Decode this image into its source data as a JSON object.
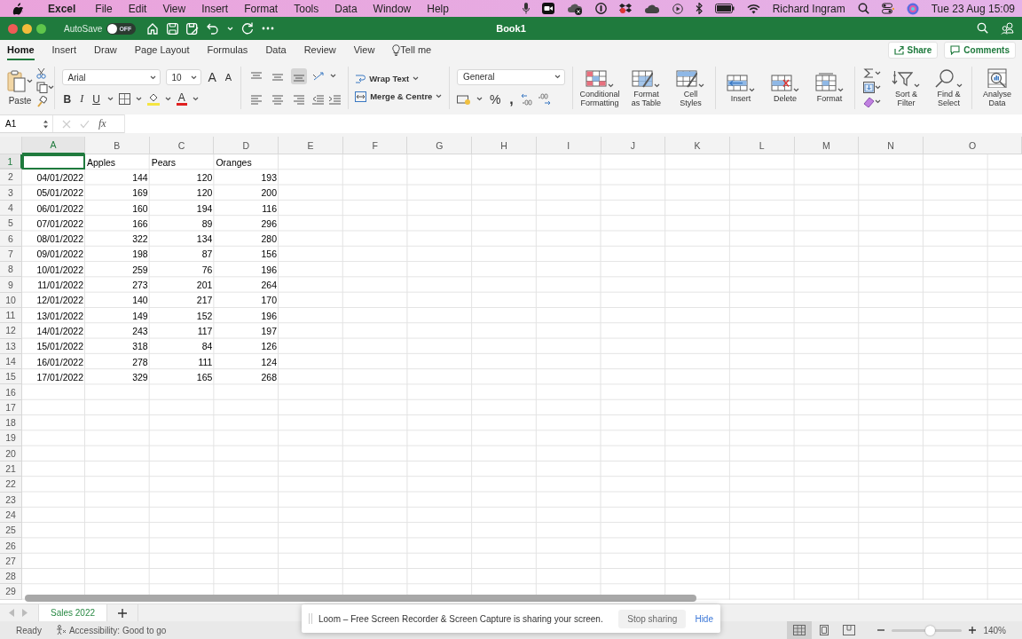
{
  "menubar": {
    "app": "Excel",
    "items": [
      "File",
      "Edit",
      "View",
      "Insert",
      "Format",
      "Tools",
      "Data",
      "Window",
      "Help"
    ],
    "user": "Richard Ingram",
    "clock": "Tue 23 Aug  15:09"
  },
  "titlebar": {
    "autosave_label": "AutoSave",
    "autosave_on": false,
    "toggle_text": "OFF",
    "title": "Book1"
  },
  "ribbon_tabs": [
    {
      "label": "Home",
      "selected": true
    },
    {
      "label": "Insert",
      "selected": false
    },
    {
      "label": "Draw",
      "selected": false
    },
    {
      "label": "Page Layout",
      "selected": false
    },
    {
      "label": "Formulas",
      "selected": false
    },
    {
      "label": "Data",
      "selected": false
    },
    {
      "label": "Review",
      "selected": false
    },
    {
      "label": "View",
      "selected": false
    }
  ],
  "tell_me": "Tell me",
  "share": "Share",
  "comments": "Comments",
  "ribbon": {
    "paste": "Paste",
    "font": {
      "name": "Arial",
      "size": "10",
      "size_buttons": [
        {
          "kind": "grow",
          "label": "A"
        },
        {
          "kind": "shrink",
          "label": "A"
        }
      ],
      "style_buttons": [
        {
          "kind": "bold",
          "label": "B"
        },
        {
          "kind": "italic",
          "label": "I"
        },
        {
          "kind": "underline",
          "label": "U"
        }
      ],
      "color_label": "A"
    },
    "alignment": {
      "vertical": [
        {
          "selected": false
        },
        {
          "selected": false
        },
        {
          "selected": true
        }
      ]
    },
    "wrap_text": "Wrap Text",
    "merge": "Merge & Centre",
    "number": {
      "format": "General",
      "symbols": [
        {
          "kind": "percent",
          "label": "%"
        },
        {
          "kind": "comma",
          "label": ","
        }
      ]
    },
    "big_buttons": [
      {
        "kind": "conditional",
        "label": "Conditional\nFormatting"
      },
      {
        "kind": "table",
        "label": "Format\nas Table"
      },
      {
        "kind": "styles",
        "label": "Cell\nStyles"
      },
      {
        "kind": "insert",
        "label": "Insert"
      },
      {
        "kind": "delete",
        "label": "Delete"
      },
      {
        "kind": "format",
        "label": "Format"
      },
      {
        "kind": "sort",
        "label": "Sort &\nFilter"
      },
      {
        "kind": "find",
        "label": "Find &\nSelect"
      },
      {
        "kind": "analyse",
        "label": "Analyse\nData"
      }
    ]
  },
  "formula_bar": {
    "cell_ref": "A1",
    "fx": "fx"
  },
  "sheet": {
    "columns": [
      {
        "label": "A",
        "selected": true
      },
      {
        "label": "B",
        "selected": false
      },
      {
        "label": "C",
        "selected": false
      },
      {
        "label": "D",
        "selected": false
      },
      {
        "label": "E",
        "selected": false
      },
      {
        "label": "F",
        "selected": false
      },
      {
        "label": "G",
        "selected": false
      },
      {
        "label": "H",
        "selected": false
      },
      {
        "label": "I",
        "selected": false
      },
      {
        "label": "J",
        "selected": false
      },
      {
        "label": "K",
        "selected": false
      },
      {
        "label": "L",
        "selected": false
      },
      {
        "label": "M",
        "selected": false
      },
      {
        "label": "N",
        "selected": false
      },
      {
        "label": "O",
        "selected": false
      }
    ],
    "rows": [
      {
        "label": "1",
        "selected": true,
        "cells": [
          {
            "kind": "blank"
          },
          {
            "kind": "text",
            "text": "Apples"
          },
          {
            "kind": "text",
            "text": "Pears"
          },
          {
            "kind": "text",
            "text": "Oranges"
          }
        ]
      },
      {
        "label": "2",
        "selected": false,
        "cells": [
          {
            "kind": "number",
            "text": "04/01/2022"
          },
          {
            "kind": "number",
            "text": "144"
          },
          {
            "kind": "number",
            "text": "120"
          },
          {
            "kind": "number",
            "text": "193"
          }
        ]
      },
      {
        "label": "3",
        "selected": false,
        "cells": [
          {
            "kind": "number",
            "text": "05/01/2022"
          },
          {
            "kind": "number",
            "text": "169"
          },
          {
            "kind": "number",
            "text": "120"
          },
          {
            "kind": "number",
            "text": "200"
          }
        ]
      },
      {
        "label": "4",
        "selected": false,
        "cells": [
          {
            "kind": "number",
            "text": "06/01/2022"
          },
          {
            "kind": "number",
            "text": "160"
          },
          {
            "kind": "number",
            "text": "194"
          },
          {
            "kind": "number",
            "text": "116"
          }
        ]
      },
      {
        "label": "5",
        "selected": false,
        "cells": [
          {
            "kind": "number",
            "text": "07/01/2022"
          },
          {
            "kind": "number",
            "text": "166"
          },
          {
            "kind": "number",
            "text": "89"
          },
          {
            "kind": "number",
            "text": "296"
          }
        ]
      },
      {
        "label": "6",
        "selected": false,
        "cells": [
          {
            "kind": "number",
            "text": "08/01/2022"
          },
          {
            "kind": "number",
            "text": "322"
          },
          {
            "kind": "number",
            "text": "134"
          },
          {
            "kind": "number",
            "text": "280"
          }
        ]
      },
      {
        "label": "7",
        "selected": false,
        "cells": [
          {
            "kind": "number",
            "text": "09/01/2022"
          },
          {
            "kind": "number",
            "text": "198"
          },
          {
            "kind": "number",
            "text": "87"
          },
          {
            "kind": "number",
            "text": "156"
          }
        ]
      },
      {
        "label": "8",
        "selected": false,
        "cells": [
          {
            "kind": "number",
            "text": "10/01/2022"
          },
          {
            "kind": "number",
            "text": "259"
          },
          {
            "kind": "number",
            "text": "76"
          },
          {
            "kind": "number",
            "text": "196"
          }
        ]
      },
      {
        "label": "9",
        "selected": false,
        "cells": [
          {
            "kind": "number",
            "text": "11/01/2022"
          },
          {
            "kind": "number",
            "text": "273"
          },
          {
            "kind": "number",
            "text": "201"
          },
          {
            "kind": "number",
            "text": "264"
          }
        ]
      },
      {
        "label": "10",
        "selected": false,
        "cells": [
          {
            "kind": "number",
            "text": "12/01/2022"
          },
          {
            "kind": "number",
            "text": "140"
          },
          {
            "kind": "number",
            "text": "217"
          },
          {
            "kind": "number",
            "text": "170"
          }
        ]
      },
      {
        "label": "11",
        "selected": false,
        "cells": [
          {
            "kind": "number",
            "text": "13/01/2022"
          },
          {
            "kind": "number",
            "text": "149"
          },
          {
            "kind": "number",
            "text": "152"
          },
          {
            "kind": "number",
            "text": "196"
          }
        ]
      },
      {
        "label": "12",
        "selected": false,
        "cells": [
          {
            "kind": "number",
            "text": "14/01/2022"
          },
          {
            "kind": "number",
            "text": "243"
          },
          {
            "kind": "number",
            "text": "117"
          },
          {
            "kind": "number",
            "text": "197"
          }
        ]
      },
      {
        "label": "13",
        "selected": false,
        "cells": [
          {
            "kind": "number",
            "text": "15/01/2022"
          },
          {
            "kind": "number",
            "text": "318"
          },
          {
            "kind": "number",
            "text": "84"
          },
          {
            "kind": "number",
            "text": "126"
          }
        ]
      },
      {
        "label": "14",
        "selected": false,
        "cells": [
          {
            "kind": "number",
            "text": "16/01/2022"
          },
          {
            "kind": "number",
            "text": "278"
          },
          {
            "kind": "number",
            "text": "111"
          },
          {
            "kind": "number",
            "text": "124"
          }
        ]
      },
      {
        "label": "15",
        "selected": false,
        "cells": [
          {
            "kind": "number",
            "text": "17/01/2022"
          },
          {
            "kind": "number",
            "text": "329"
          },
          {
            "kind": "number",
            "text": "165"
          },
          {
            "kind": "number",
            "text": "268"
          }
        ]
      },
      {
        "label": "16",
        "selected": false
      },
      {
        "label": "17",
        "selected": false
      },
      {
        "label": "18",
        "selected": false
      },
      {
        "label": "19",
        "selected": false
      },
      {
        "label": "20",
        "selected": false
      },
      {
        "label": "21",
        "selected": false
      },
      {
        "label": "22",
        "selected": false
      },
      {
        "label": "23",
        "selected": false
      },
      {
        "label": "24",
        "selected": false
      },
      {
        "label": "25",
        "selected": false
      },
      {
        "label": "26",
        "selected": false
      },
      {
        "label": "27",
        "selected": false
      },
      {
        "label": "28",
        "selected": false
      },
      {
        "label": "29",
        "selected": false
      }
    ]
  },
  "sheet_tabs": [
    {
      "label": "Sales 2022",
      "selected": true
    }
  ],
  "status_bar": {
    "ready": "Ready",
    "accessibility": "Accessibility: Good to go",
    "views": [
      {
        "kind": "normal",
        "selected": true
      },
      {
        "kind": "page_layout",
        "selected": false
      },
      {
        "kind": "page_break",
        "selected": false
      }
    ],
    "zoom": {
      "level": 0.54,
      "reading": "140%"
    }
  },
  "loom": {
    "message": "Loom – Free Screen Recorder & Screen Capture is sharing your screen.",
    "stop": "Stop sharing",
    "hide": "Hide"
  }
}
